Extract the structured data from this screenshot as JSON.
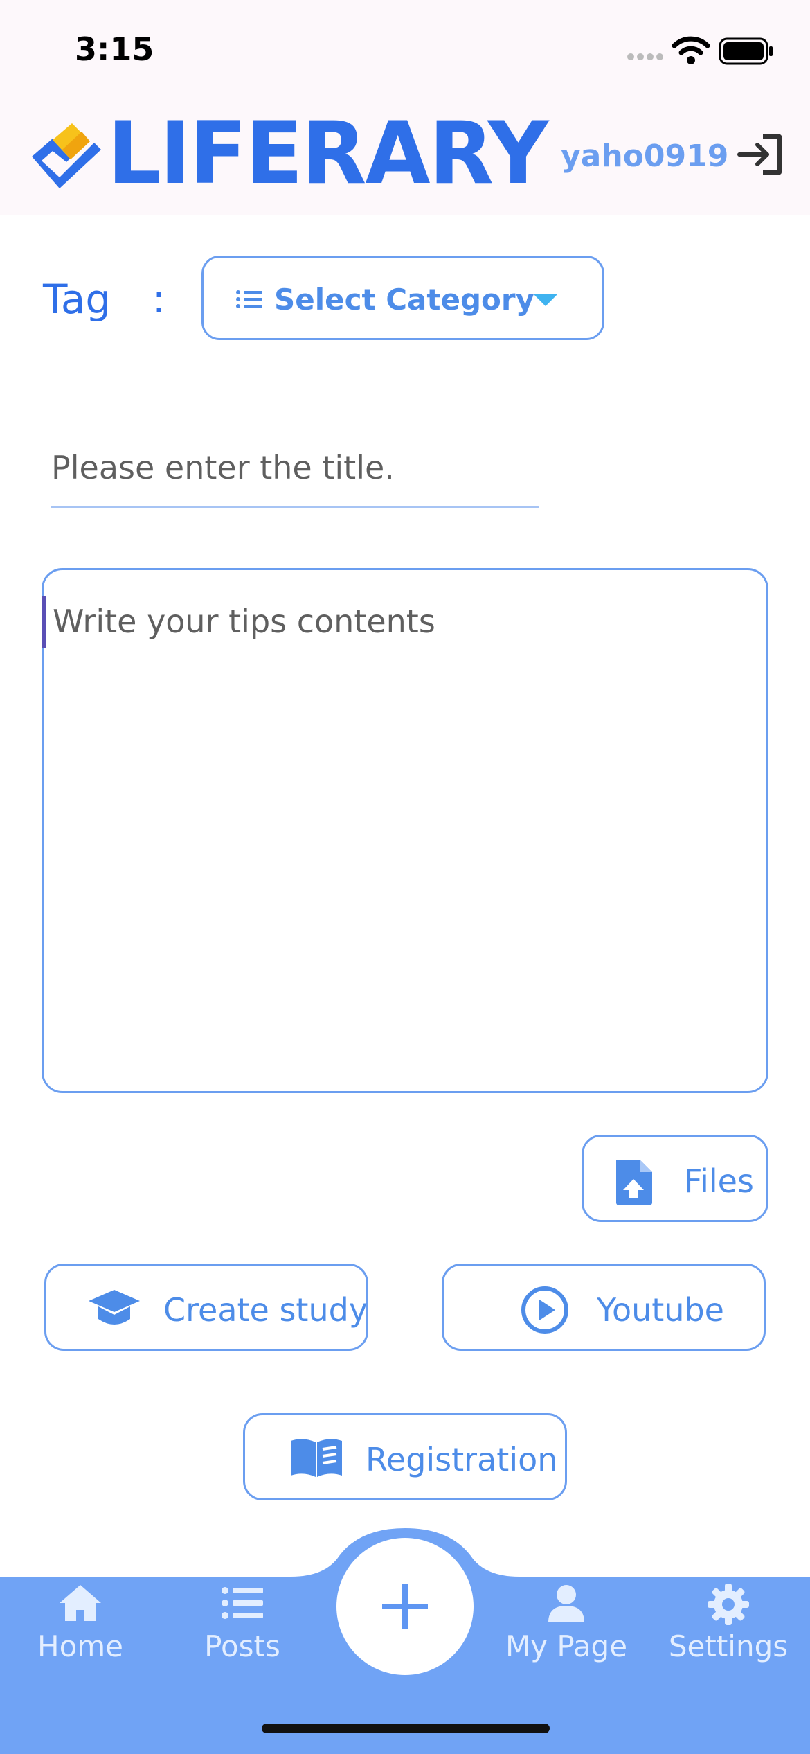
{
  "status_bar": {
    "time": "3:15"
  },
  "header": {
    "logo_text": "LIFERARY",
    "username": "yaho0919"
  },
  "tag": {
    "label": "Tag",
    "colon": ":",
    "category_button": "Select Category"
  },
  "title_input": {
    "placeholder": "Please enter the title.",
    "value": ""
  },
  "content_input": {
    "placeholder": "Write your tips contents",
    "value": ""
  },
  "buttons": {
    "files": "Files",
    "create_study": "Create study",
    "youtube": "Youtube",
    "registration": "Registration"
  },
  "bottom_nav": {
    "items": [
      {
        "label": "Home",
        "icon": "home-icon"
      },
      {
        "label": "Posts",
        "icon": "list-icon"
      },
      {
        "label": "",
        "icon": "plus-icon"
      },
      {
        "label": "My Page",
        "icon": "person-icon"
      },
      {
        "label": "Settings",
        "icon": "gear-icon"
      }
    ]
  },
  "colors": {
    "brand_blue": "#2f6fe8",
    "accent_blue": "#6b9ef0",
    "nav_bg": "#70a3f5",
    "logo_yellow": "#f7c21b"
  }
}
